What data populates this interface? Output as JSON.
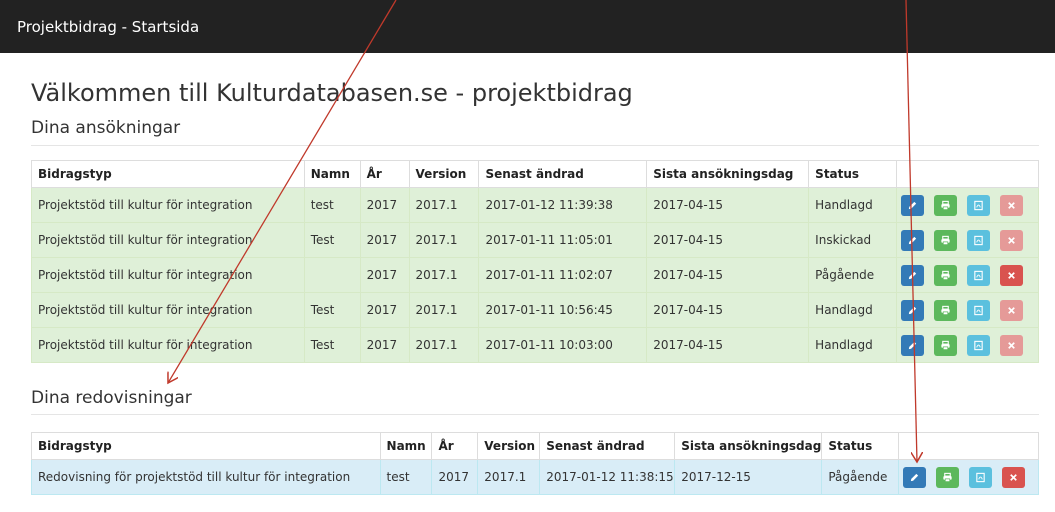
{
  "navbar": {
    "brand": "Projektbidrag - Startsida"
  },
  "page": {
    "title": "Välkommen till Kulturdatabasen.se - projektbidrag",
    "applications_heading": "Dina ansökningar",
    "reports_heading": "Dina redovisningar"
  },
  "applications": {
    "headers": [
      "Bidragstyp",
      "Namn",
      "År",
      "Version",
      "Senast ändrad",
      "Sista ansökningsdag",
      "Status"
    ],
    "rows": [
      [
        "Projektstöd till kultur för integration",
        "test",
        "2017",
        "2017.1",
        "2017-01-12 11:39:38",
        "2017-04-15",
        "Handlagd"
      ],
      [
        "Projektstöd till kultur för integration",
        "Test",
        "2017",
        "2017.1",
        "2017-01-11 11:05:01",
        "2017-04-15",
        "Inskickad"
      ],
      [
        "Projektstöd till kultur för integration",
        "",
        "2017",
        "2017.1",
        "2017-01-11 11:02:07",
        "2017-04-15",
        "Pågående"
      ],
      [
        "Projektstöd till kultur för integration",
        "Test",
        "2017",
        "2017.1",
        "2017-01-11 10:56:45",
        "2017-04-15",
        "Handlagd"
      ],
      [
        "Projektstöd till kultur för integration",
        "Test",
        "2017",
        "2017.1",
        "2017-01-11 10:03:00",
        "2017-04-15",
        "Handlagd"
      ]
    ],
    "delete_enabled": [
      false,
      false,
      true,
      false,
      false
    ]
  },
  "reports": {
    "headers": [
      "Bidragstyp",
      "Namn",
      "År",
      "Version",
      "Senast ändrad",
      "Sista ansökningsdag",
      "Status"
    ],
    "rows": [
      [
        "Redovisning för projektstöd till kultur för integration",
        "test",
        "2017",
        "2017.1",
        "2017-01-12 11:38:15",
        "2017-12-15",
        "Pågående"
      ]
    ],
    "delete_enabled": [
      true
    ]
  },
  "icons": {
    "edit": "pencil-icon",
    "print": "printer-icon",
    "pdf": "pdf-document-icon",
    "delete": "close-icon"
  },
  "colors": {
    "navbar": "#222222",
    "row_success": "#dff0d8",
    "row_info": "#d9edf7",
    "btn_edit": "#337ab7",
    "btn_print": "#5cb85c",
    "btn_pdf": "#5bc0de",
    "btn_delete": "#d9534f",
    "annotation_arrow": "#c0392b"
  }
}
